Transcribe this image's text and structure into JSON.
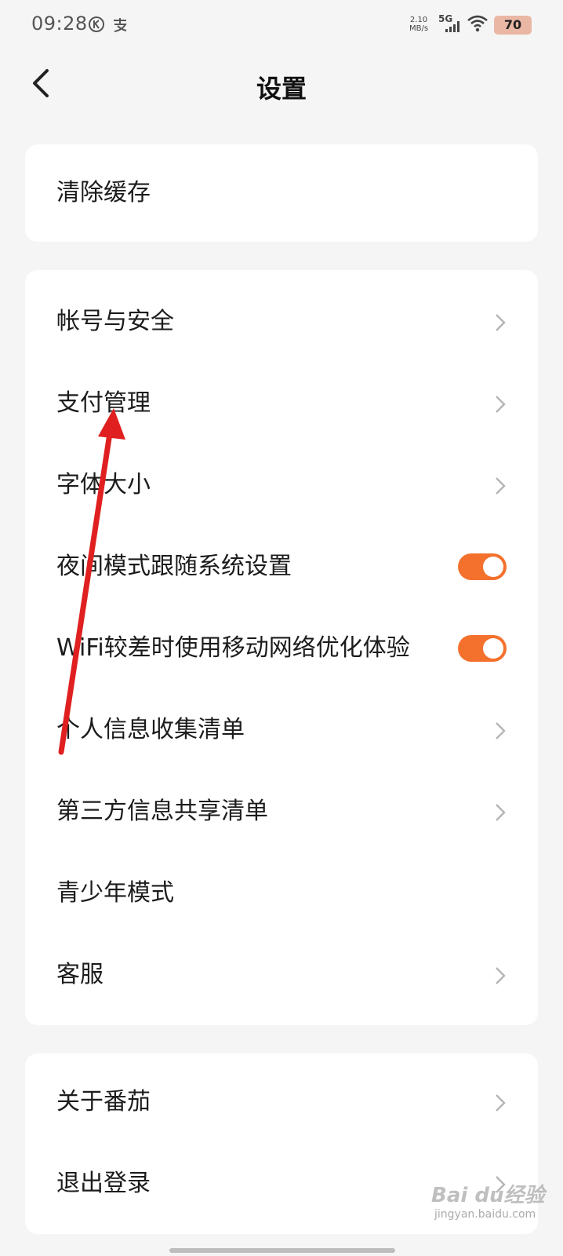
{
  "status_bar": {
    "time": "09:28",
    "speed_value": "2.10",
    "speed_unit": "MB/s",
    "network": "5G",
    "battery": "70"
  },
  "header": {
    "title": "设置"
  },
  "cards": {
    "cache": {
      "label": "清除缓存"
    },
    "main": {
      "account_security": "帐号与安全",
      "payment": "支付管理",
      "font_size": "字体大小",
      "night_mode": "夜间模式跟随系统设置",
      "wifi_opt": "WiFi较差时使用移动网络优化体验",
      "personal_info": "个人信息收集清单",
      "third_party": "第三方信息共享清单",
      "teen_mode": "青少年模式",
      "customer_service": "客服"
    },
    "about": {
      "about": "关于番茄",
      "logout": "退出登录"
    }
  },
  "toggles": {
    "night_mode": true,
    "wifi_opt": true
  },
  "colors": {
    "accent": "#f4712d",
    "annotation_arrow": "#e02020",
    "background": "#f5f5f5"
  },
  "watermark": {
    "main": "Bai du经验",
    "sub": "jingyan.baidu.com"
  }
}
